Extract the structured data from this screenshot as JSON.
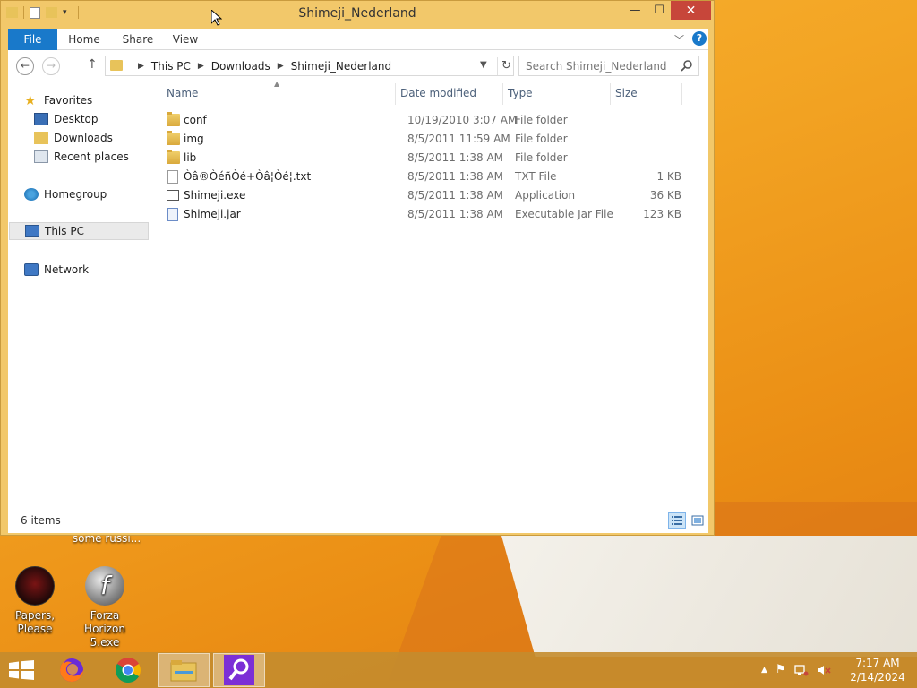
{
  "window": {
    "title": "Shimeji_Nederland",
    "minimize_glyph": "—",
    "maximize_glyph": "☐",
    "close_glyph": "✕"
  },
  "ribbon": {
    "tabs": [
      "File",
      "Home",
      "Share",
      "View"
    ],
    "help_glyph": "?"
  },
  "address": {
    "crumbs": [
      "This PC",
      "Downloads",
      "Shimeji_Nederland"
    ]
  },
  "search": {
    "placeholder": "Search Shimeji_Nederland"
  },
  "navpane": {
    "favorites": "Favorites",
    "desktop": "Desktop",
    "downloads": "Downloads",
    "recent": "Recent places",
    "homegroup": "Homegroup",
    "this_pc": "This PC",
    "network": "Network"
  },
  "columns": {
    "name": "Name",
    "date": "Date modified",
    "type": "Type",
    "size": "Size"
  },
  "files": [
    {
      "name": "conf",
      "date": "10/19/2010 3:07 AM",
      "type": "File folder",
      "size": "",
      "icon": "folder-icon"
    },
    {
      "name": "img",
      "date": "8/5/2011 11:59 AM",
      "type": "File folder",
      "size": "",
      "icon": "folder-icon"
    },
    {
      "name": "lib",
      "date": "8/5/2011 1:38 AM",
      "type": "File folder",
      "size": "",
      "icon": "folder-icon"
    },
    {
      "name": "Òâ®ÒéñÒé+Òâ¦Òé¦.txt",
      "date": "8/5/2011 1:38 AM",
      "type": "TXT File",
      "size": "1 KB",
      "icon": "text-file-icon"
    },
    {
      "name": "Shimeji.exe",
      "date": "8/5/2011 1:38 AM",
      "type": "Application",
      "size": "36 KB",
      "icon": "application-icon"
    },
    {
      "name": "Shimeji.jar",
      "date": "8/5/2011 1:38 AM",
      "type": "Executable Jar File",
      "size": "123 KB",
      "icon": "java-jar-icon"
    }
  ],
  "status": {
    "item_count": "6 items"
  },
  "desktop": {
    "icons": [
      {
        "label": "Papers, Please"
      },
      {
        "label": "Forza Horizon 5.exe"
      }
    ],
    "partial_label": "some russi..."
  },
  "clock": {
    "time": "7:17 AM",
    "date": "2/14/2024"
  },
  "colors": {
    "accent": "#1979ca",
    "window_frame": "#f2c86a",
    "close": "#c7463a"
  }
}
